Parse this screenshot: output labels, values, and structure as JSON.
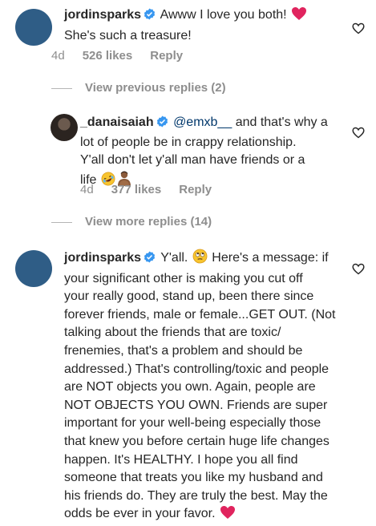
{
  "comments": [
    {
      "username": "jordinsparks",
      "text": "Awww I love you both!",
      "text_line2": "She's such a treasure!",
      "time": "4d",
      "likes": "526 likes",
      "reply": "Reply"
    },
    {
      "username": "_danaisaiah",
      "mention": "@emxb__",
      "text": "and that's why a",
      "text_line2": "lot of people be in crappy relationship.",
      "text_line3": "Y'all don't let y'all man have friends or a",
      "text_line4": "life",
      "time": "4d",
      "likes": "377 likes",
      "reply": "Reply"
    },
    {
      "username": "jordinsparks",
      "text_first": "Y'all.",
      "text_after_emoji": "Here's a message: if",
      "lines": [
        "your significant other is making you cut off",
        "your really good, stand up, been there since",
        "forever friends, male or female...GET OUT. (Not",
        "talking about the friends that are toxic/",
        "frenemies, that's a problem and should be",
        "addressed.) That's controlling/toxic and people",
        "are NOT objects you own. Again, people are",
        "NOT OBJECTS YOU OWN. Friends are super",
        "important for your well-being especially those",
        "that knew you before certain huge life changes",
        "happen. It's HEALTHY. I hope you all find",
        "someone that treats you like my husband and",
        "his friends do. They are truly the best. May the",
        "odds be ever in your favor."
      ]
    }
  ],
  "view_previous_replies": "View previous replies (2)",
  "view_more_replies": "View more replies (14)",
  "colors": {
    "avatar": "#2f5d86",
    "heart_red": "#e0245e",
    "verified_blue": "#3897f0",
    "meta_gray": "#8e8e8e"
  }
}
